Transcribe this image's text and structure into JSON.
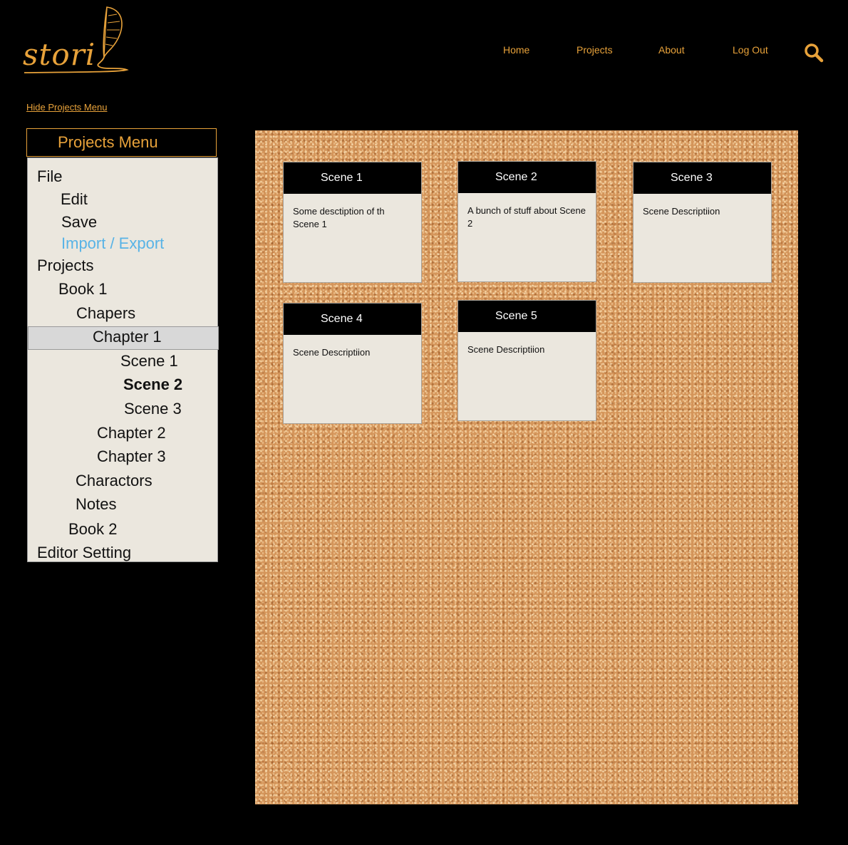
{
  "header": {
    "logo_text": "stori",
    "nav": [
      "Home",
      "Projects",
      "About",
      "Log Out"
    ],
    "search_icon": "search-icon",
    "accent_color": "#e8a23a"
  },
  "sidebar": {
    "hide_link": "Hide Projects Menu",
    "menu_title": "Projects Menu",
    "items": {
      "file": "File",
      "edit": "Edit",
      "save": "Save",
      "import_export": "Import / Export",
      "projects": "Projects",
      "book1": "Book 1",
      "chapers": "Chapers",
      "chapter1": "Chapter 1",
      "scene1": "Scene 1",
      "scene2": "Scene 2",
      "scene3": "Scene 3",
      "chapter2": "Chapter 2",
      "chapter3": "Chapter 3",
      "charactors": "Charactors",
      "notes": "Notes",
      "book2": "Book 2",
      "editor_setting": "Editor Setting"
    },
    "selected_item": "Chapter 1",
    "active_scene": "Scene 2"
  },
  "board": {
    "cards": [
      {
        "title": "Scene 1",
        "desc": "Some desctiption of th Scene 1"
      },
      {
        "title": "Scene 2",
        "desc": "A bunch of stuff about Scene 2"
      },
      {
        "title": "Scene 3",
        "desc": "Scene Descriptiion"
      },
      {
        "title": "Scene 4",
        "desc": "Scene Descriptiion"
      },
      {
        "title": "Scene 5",
        "desc": "Scene Descriptiion"
      }
    ]
  }
}
